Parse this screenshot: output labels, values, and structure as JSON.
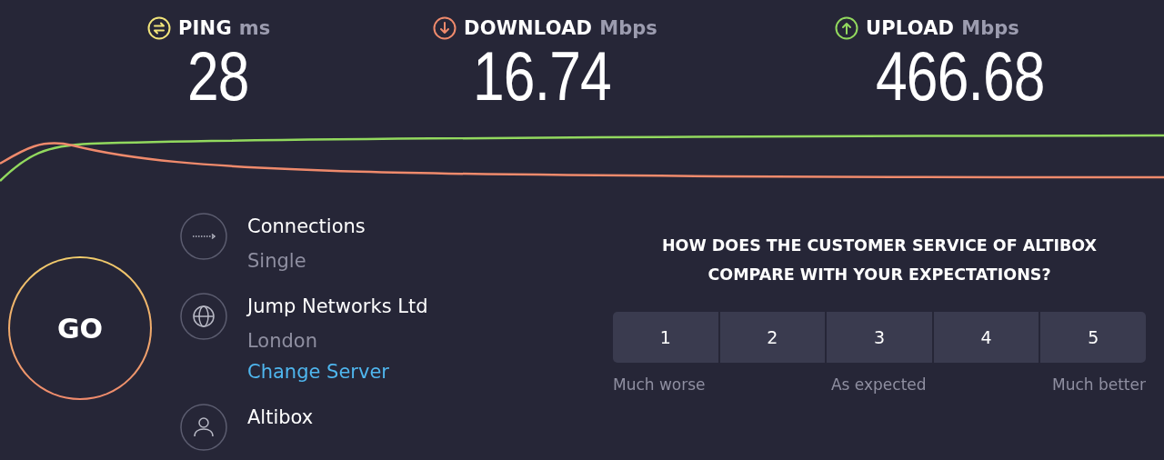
{
  "metrics": [
    {
      "kind": "ping",
      "label": "PING",
      "unit": "ms",
      "value": "28",
      "color": "#f1e47a"
    },
    {
      "kind": "download",
      "label": "DOWNLOAD",
      "unit": "Mbps",
      "value": "16.74",
      "color": "#ef8a6c"
    },
    {
      "kind": "upload",
      "label": "UPLOAD",
      "unit": "Mbps",
      "value": "466.68",
      "color": "#92d95e"
    }
  ],
  "go_button": {
    "label": "GO"
  },
  "info": [
    {
      "kind": "connections",
      "title": "Connections",
      "subtitle": "Single"
    },
    {
      "kind": "server",
      "title": "Jump Networks Ltd",
      "subtitle": "London",
      "link": "Change Server"
    },
    {
      "kind": "provider",
      "title": "Altibox"
    }
  ],
  "survey": {
    "question": "HOW DOES THE CUSTOMER SERVICE OF ALTIBOX COMPARE WITH YOUR EXPECTATIONS?",
    "options": [
      {
        "label": "1",
        "selected": false
      },
      {
        "label": "2",
        "selected": false
      },
      {
        "label": "3",
        "selected": false
      },
      {
        "label": "4",
        "selected": false
      },
      {
        "label": "5",
        "selected": false
      }
    ],
    "scale_labels": [
      "Much worse",
      "As expected",
      "Much better"
    ]
  }
}
